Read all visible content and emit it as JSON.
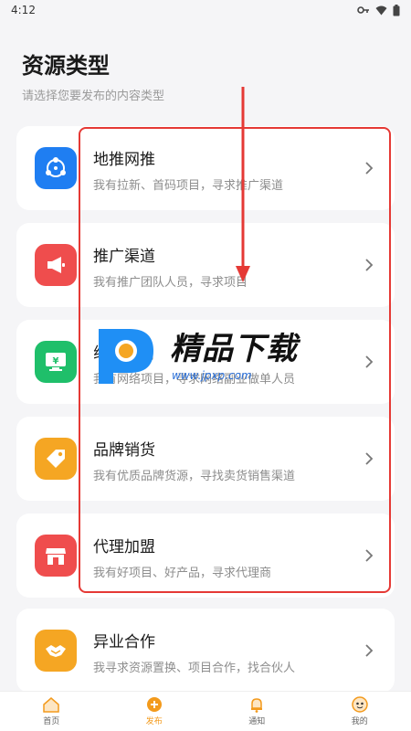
{
  "status_bar": {
    "time": "4:12"
  },
  "header": {
    "title": "资源类型",
    "subtitle": "请选择您要发布的内容类型"
  },
  "cards": [
    {
      "title": "地推网推",
      "desc": "我有拉新、首码项目，寻求推广渠道",
      "icon": "share-icon",
      "color": "#1f7ef2"
    },
    {
      "title": "推广渠道",
      "desc": "我有推广团队人员，寻求项目",
      "icon": "megaphone-icon",
      "color": "#ef4d4d"
    },
    {
      "title": "线上项目",
      "desc": "我有网络项目，寻求网络副业做单人员",
      "icon": "monitor-yuan-icon",
      "color": "#1fbf6a"
    },
    {
      "title": "品牌销货",
      "desc": "我有优质品牌货源，寻找卖货销售渠道",
      "icon": "tag-icon",
      "color": "#f5a623"
    },
    {
      "title": "代理加盟",
      "desc": "我有好项目、好产品，寻求代理商",
      "icon": "storefront-icon",
      "color": "#ef4d4d"
    },
    {
      "title": "异业合作",
      "desc": "我寻求资源置换、项目合作，找合伙人",
      "icon": "handshake-icon",
      "color": "#f5a623"
    }
  ],
  "watermark": {
    "text": "精品下载",
    "url": "www.jpxp.com"
  },
  "tabs": [
    {
      "label": "首页",
      "icon": "home-icon"
    },
    {
      "label": "发布",
      "icon": "plus-circle-icon"
    },
    {
      "label": "通知",
      "icon": "bell-icon"
    },
    {
      "label": "我的",
      "icon": "face-icon"
    }
  ],
  "colors": {
    "accent": "#f39a1c",
    "annotation_red": "#e53935"
  }
}
